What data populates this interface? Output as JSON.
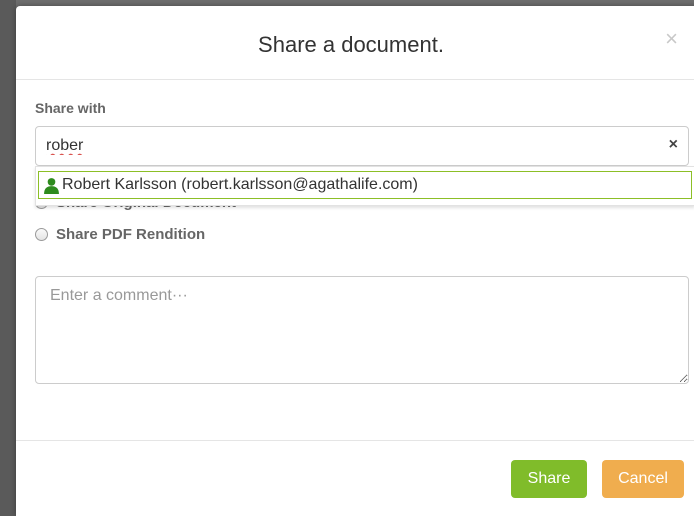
{
  "dialog": {
    "title": "Share a document.",
    "close_glyph": "×"
  },
  "share_with": {
    "label": "Share with",
    "input_value": "rober",
    "clear_glyph": "×",
    "suggestions": [
      {
        "label": "Robert Karlsson (robert.karlsson@agathalife.com)",
        "icon": "user-icon"
      }
    ]
  },
  "options": [
    {
      "label": "Share Original Document",
      "selected": false
    },
    {
      "label": "Share PDF Rendition",
      "selected": false
    }
  ],
  "comment": {
    "placeholder": "Enter a comment···",
    "value": ""
  },
  "buttons": {
    "share_label": "Share",
    "cancel_label": "Cancel"
  },
  "colors": {
    "share_button": "#80bc2a",
    "cancel_button": "#f0ad4e",
    "suggestion_highlight": "#8cbf26",
    "user_icon": "#2e8b1e"
  }
}
